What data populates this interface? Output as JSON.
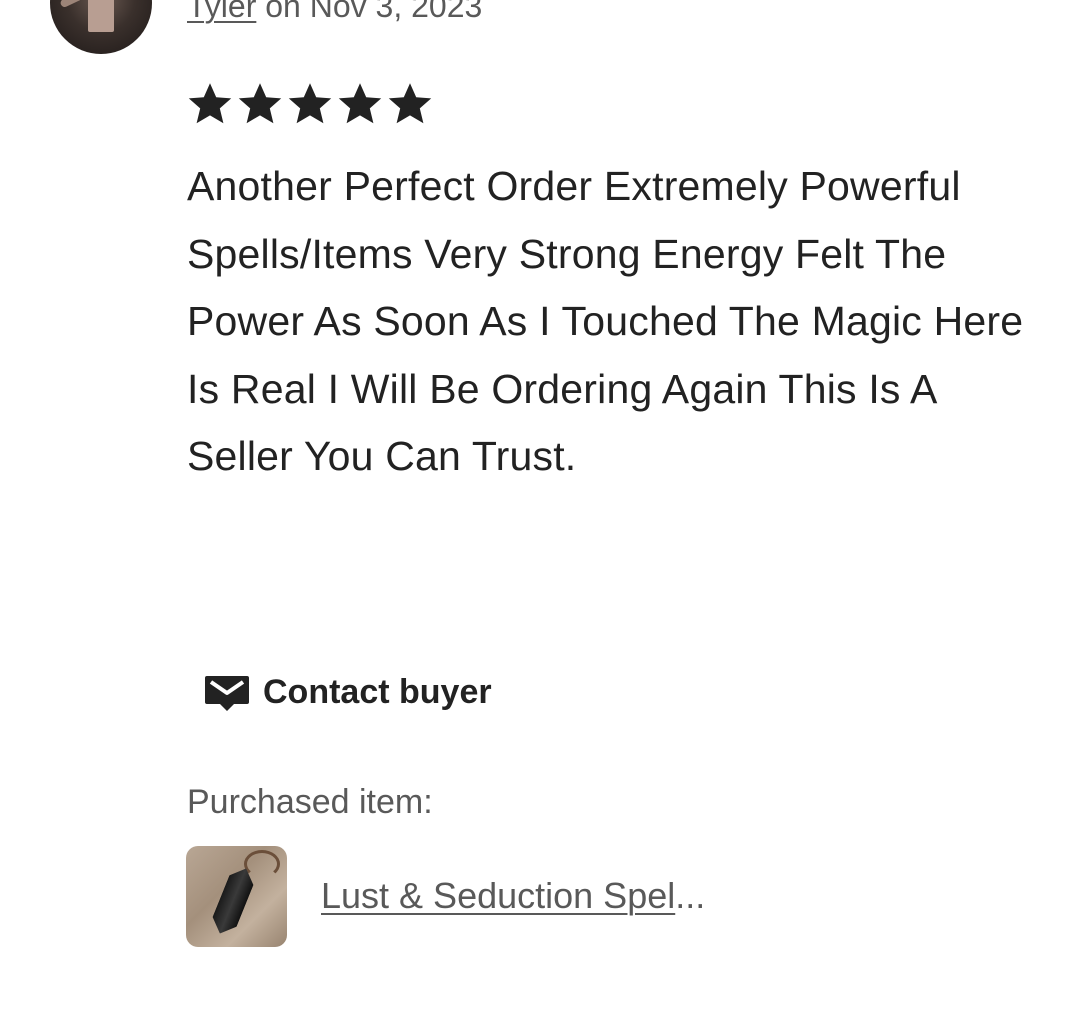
{
  "review": {
    "reviewer_name": "Tyler",
    "date_text": " on Nov 3, 2023",
    "rating": 5,
    "rating_max": 5,
    "text": "Another Perfect Order Extremely Powerful Spells/Items Very Strong Energy Felt The Power As Soon As I Touched The Magic Here Is Real I Will Be Ordering Again This Is A Seller You Can Trust."
  },
  "actions": {
    "contact_label": "Contact buyer",
    "contact_icon": "mail-icon"
  },
  "purchased": {
    "label": "Purchased item:",
    "item_title": "Lust & Seduction Spel",
    "item_ellipsis": "..."
  },
  "colors": {
    "text_primary": "#222222",
    "text_secondary": "#595959",
    "star": "#222222"
  }
}
